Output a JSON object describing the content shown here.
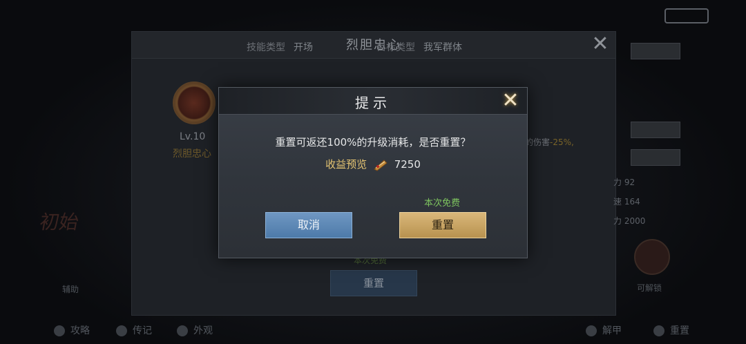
{
  "background": {
    "skill_window": {
      "title": "烈胆忠心",
      "skill_type_label": "技能类型",
      "skill_type_value": "开场",
      "target_type_label": "目标类型",
      "target_type_value": "我军群体",
      "level": "Lv.10",
      "skill_name": "烈胆忠心",
      "damage_text": "的伤害",
      "damage_value": "-25%,",
      "free_label": "本次免费",
      "reset_button": "重置"
    },
    "right_panel": {
      "stats": [
        "力 92",
        "速 164",
        "力 2000"
      ],
      "badge_label": "可解锁"
    },
    "left_small": "辅助",
    "bottom_bar": [
      "攻略",
      "传记",
      "外观",
      "解甲",
      "重置"
    ]
  },
  "modal": {
    "title": "提示",
    "message": "重置可返还100%的升级消耗，是否重置？",
    "reward_label": "收益预览",
    "reward_icon": "scroll-icon",
    "reward_amount": "7250",
    "free_label": "本次免费",
    "cancel_button": "取消",
    "reset_button": "重置",
    "colors": {
      "cancel": "#5a86b5",
      "reset": "#c9a462",
      "free": "#7ec45f",
      "reward_label": "#e5c472"
    }
  }
}
